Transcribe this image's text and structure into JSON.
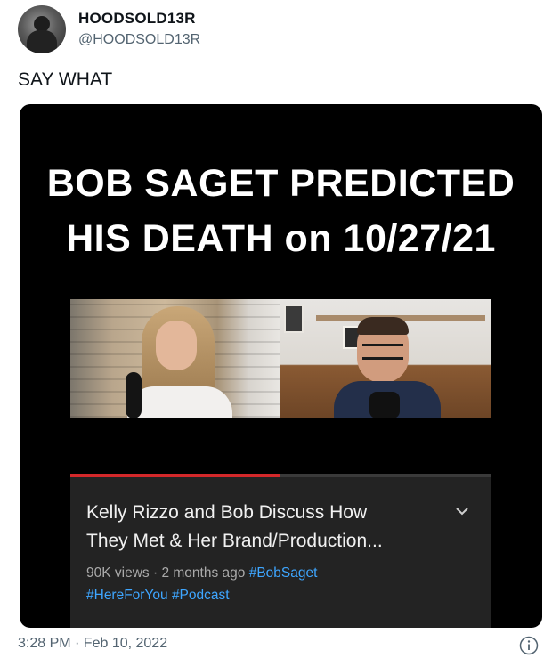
{
  "author": {
    "display_name": "HOODSOLD13R",
    "handle": "@HOODSOLD13R"
  },
  "tweet": {
    "text": "SAY WHAT",
    "timestamp": "3:28 PM · Feb 10, 2022"
  },
  "media": {
    "headline_line1": "BOB SAGET PREDICTED",
    "headline_line2": "HIS DEATH on 10/27/21",
    "video": {
      "title_line1": "Kelly Rizzo and Bob Discuss How",
      "title_line2": "They Met & Her Brand/Production...",
      "views": "90K views",
      "separator": "·",
      "age": "2 months ago",
      "hashtags": [
        "#BobSaget",
        "#HereForYou",
        "#Podcast"
      ],
      "progress_fraction": 0.5,
      "expand_icon": "chevron-down-icon"
    }
  },
  "colors": {
    "handle": "#536471",
    "hashtag": "#3ea6ff",
    "progress": "#d3282a",
    "panel_bg": "#232323"
  },
  "icons": {
    "info": "info-icon"
  }
}
